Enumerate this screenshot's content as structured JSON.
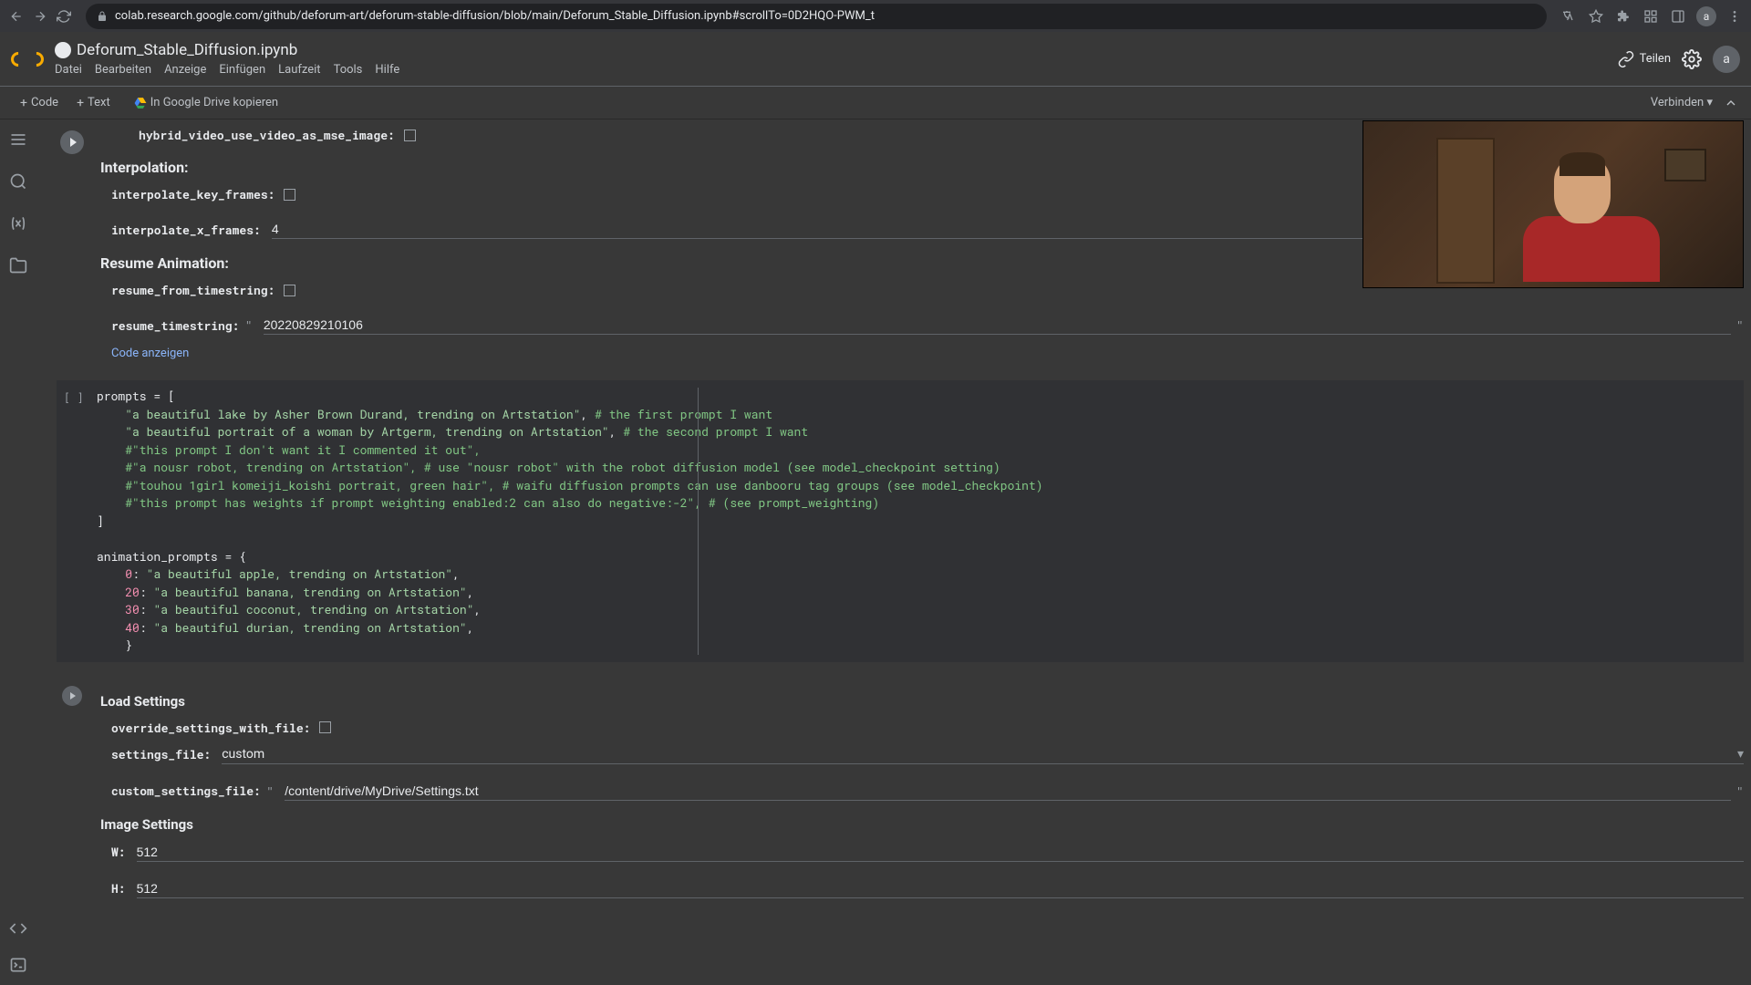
{
  "browser": {
    "url": "colab.research.google.com/github/deforum-art/deforum-stable-diffusion/blob/main/Deforum_Stable_Diffusion.ipynb#scrollTo=0D2HQO-PWM_t"
  },
  "header": {
    "title": "Deforum_Stable_Diffusion.ipynb",
    "menus": [
      "Datei",
      "Bearbeiten",
      "Anzeige",
      "Einfügen",
      "Laufzeit",
      "Tools",
      "Hilfe"
    ],
    "share": "Teilen",
    "avatar": "a"
  },
  "toolbar": {
    "code": "Code",
    "text": "Text",
    "drive": "In Google Drive kopieren",
    "connect": "Verbinden"
  },
  "cell1": {
    "hybrid_label": "hybrid_video_use_video_as_mse_image:",
    "interpolation_title": "Interpolation:",
    "interpolate_key_frames_label": "interpolate_key_frames:",
    "interpolate_x_frames_label": "interpolate_x_frames:",
    "interpolate_x_frames_value": "4",
    "resume_title": "Resume Animation:",
    "resume_from_timestring_label": "resume_from_timestring:",
    "resume_timestring_label": "resume_timestring:",
    "resume_timestring_value": "20220829210106",
    "code_link": "Code anzeigen"
  },
  "code": {
    "gutter": "[ ]",
    "l1a": "prompts ",
    "l1b": "=",
    "l1c": " [",
    "l2a": "    ",
    "l2b": "\"a beautiful lake by Asher Brown Durand, trending on Artstation\"",
    "l2c": ", ",
    "l2d": "# the first prompt I want",
    "l3a": "    ",
    "l3b": "\"a beautiful portrait of a woman by Artgerm, trending on Artstation\"",
    "l3c": ", ",
    "l3d": "# the second prompt I want",
    "l4": "    #\"this prompt I don't want it I commented it out\",",
    "l5": "    #\"a nousr robot, trending on Artstation\", # use \"nousr robot\" with the robot diffusion model (see model_checkpoint setting)",
    "l6": "    #\"touhou 1girl komeiji_koishi portrait, green hair\", # waifu diffusion prompts can use danbooru tag groups (see model_checkpoint)",
    "l7": "    #\"this prompt has weights if prompt weighting enabled:2 can also do negative:-2\", # (see prompt_weighting)",
    "l8": "]",
    "l9": "",
    "l10a": "animation_prompts ",
    "l10b": "=",
    "l10c": " {",
    "l11a": "    ",
    "l11b": "0",
    "l11c": ": ",
    "l11d": "\"a beautiful apple, trending on Artstation\"",
    "l11e": ",",
    "l12a": "    ",
    "l12b": "20",
    "l12c": ": ",
    "l12d": "\"a beautiful banana, trending on Artstation\"",
    "l12e": ",",
    "l13a": "    ",
    "l13b": "30",
    "l13c": ": ",
    "l13d": "\"a beautiful coconut, trending on Artstation\"",
    "l13e": ",",
    "l14a": "    ",
    "l14b": "40",
    "l14c": ": ",
    "l14d": "\"a beautiful durian, trending on Artstation\"",
    "l14e": ",",
    "l15": "    }"
  },
  "load": {
    "title": "Load Settings",
    "override_label": "override_settings_with_file:",
    "settings_file_label": "settings_file:",
    "settings_file_value": "custom",
    "custom_settings_label": "custom_settings_file:",
    "custom_settings_value": "/content/drive/MyDrive/Settings.txt",
    "image_title": "Image Settings",
    "w_label": "W:",
    "w_value": "512",
    "h_label": "H:",
    "h_value": "512"
  }
}
